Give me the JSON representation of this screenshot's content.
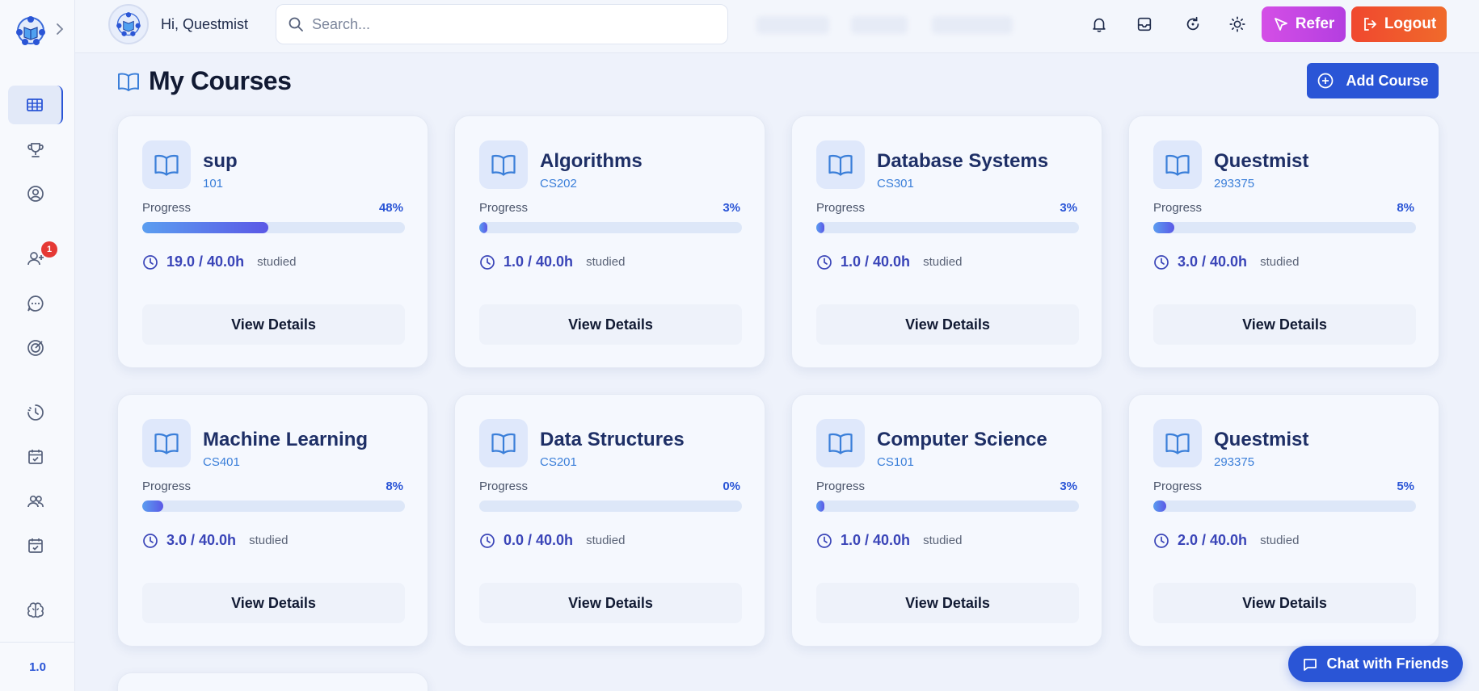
{
  "sidebar": {
    "notification_count": "1",
    "version": "1.0",
    "items": [
      {
        "name": "sidebar-item-dashboard",
        "icon": "grid-icon",
        "top": 0
      },
      {
        "name": "sidebar-item-achievements",
        "icon": "trophy-icon"
      },
      {
        "name": "sidebar-item-profile",
        "icon": "user-circle-icon"
      },
      {
        "name": "sidebar-item-friend-requests",
        "icon": "user-plus-icon"
      },
      {
        "name": "sidebar-item-messages",
        "icon": "message-icon"
      },
      {
        "name": "sidebar-item-goals",
        "icon": "target-icon"
      },
      {
        "name": "sidebar-item-timer",
        "icon": "clock-half-icon"
      },
      {
        "name": "sidebar-item-calendar",
        "icon": "calendar-check-icon"
      },
      {
        "name": "sidebar-item-groups",
        "icon": "users-icon"
      },
      {
        "name": "sidebar-item-schedule",
        "icon": "calendar-check-icon"
      },
      {
        "name": "sidebar-item-ai",
        "icon": "brain-icon"
      }
    ]
  },
  "header": {
    "greeting": "Hi, Questmist",
    "search_placeholder": "Search...",
    "refer_label": "Refer",
    "logout_label": "Logout"
  },
  "main": {
    "title": "My Courses",
    "add_course_label": "Add Course",
    "progress_label": "Progress",
    "studied_label": "studied",
    "view_details_label": "View Details",
    "courses": [
      {
        "name": "sup",
        "code": "101",
        "progress": "48%",
        "progress_value": 48,
        "hours": "19.0 / 40.0h"
      },
      {
        "name": "Algorithms",
        "code": "CS202",
        "progress": "3%",
        "progress_value": 3,
        "hours": "1.0 / 40.0h"
      },
      {
        "name": "Database Systems",
        "code": "CS301",
        "progress": "3%",
        "progress_value": 3,
        "hours": "1.0 / 40.0h"
      },
      {
        "name": "Questmist",
        "code": "293375",
        "progress": "8%",
        "progress_value": 8,
        "hours": "3.0 / 40.0h"
      },
      {
        "name": "Machine Learning",
        "code": "CS401",
        "progress": "8%",
        "progress_value": 8,
        "hours": "3.0 / 40.0h"
      },
      {
        "name": "Data Structures",
        "code": "CS201",
        "progress": "0%",
        "progress_value": 0,
        "hours": "0.0 / 40.0h"
      },
      {
        "name": "Computer Science",
        "code": "CS101",
        "progress": "3%",
        "progress_value": 3,
        "hours": "1.0 / 40.0h"
      },
      {
        "name": "Questmist",
        "code": "293375",
        "progress": "5%",
        "progress_value": 5,
        "hours": "2.0 / 40.0h"
      }
    ]
  },
  "chat": {
    "label": "Chat with Friends"
  },
  "colors": {
    "accent": "#2a55d6",
    "refer": "#c646e3",
    "logout": "#f0552d"
  }
}
